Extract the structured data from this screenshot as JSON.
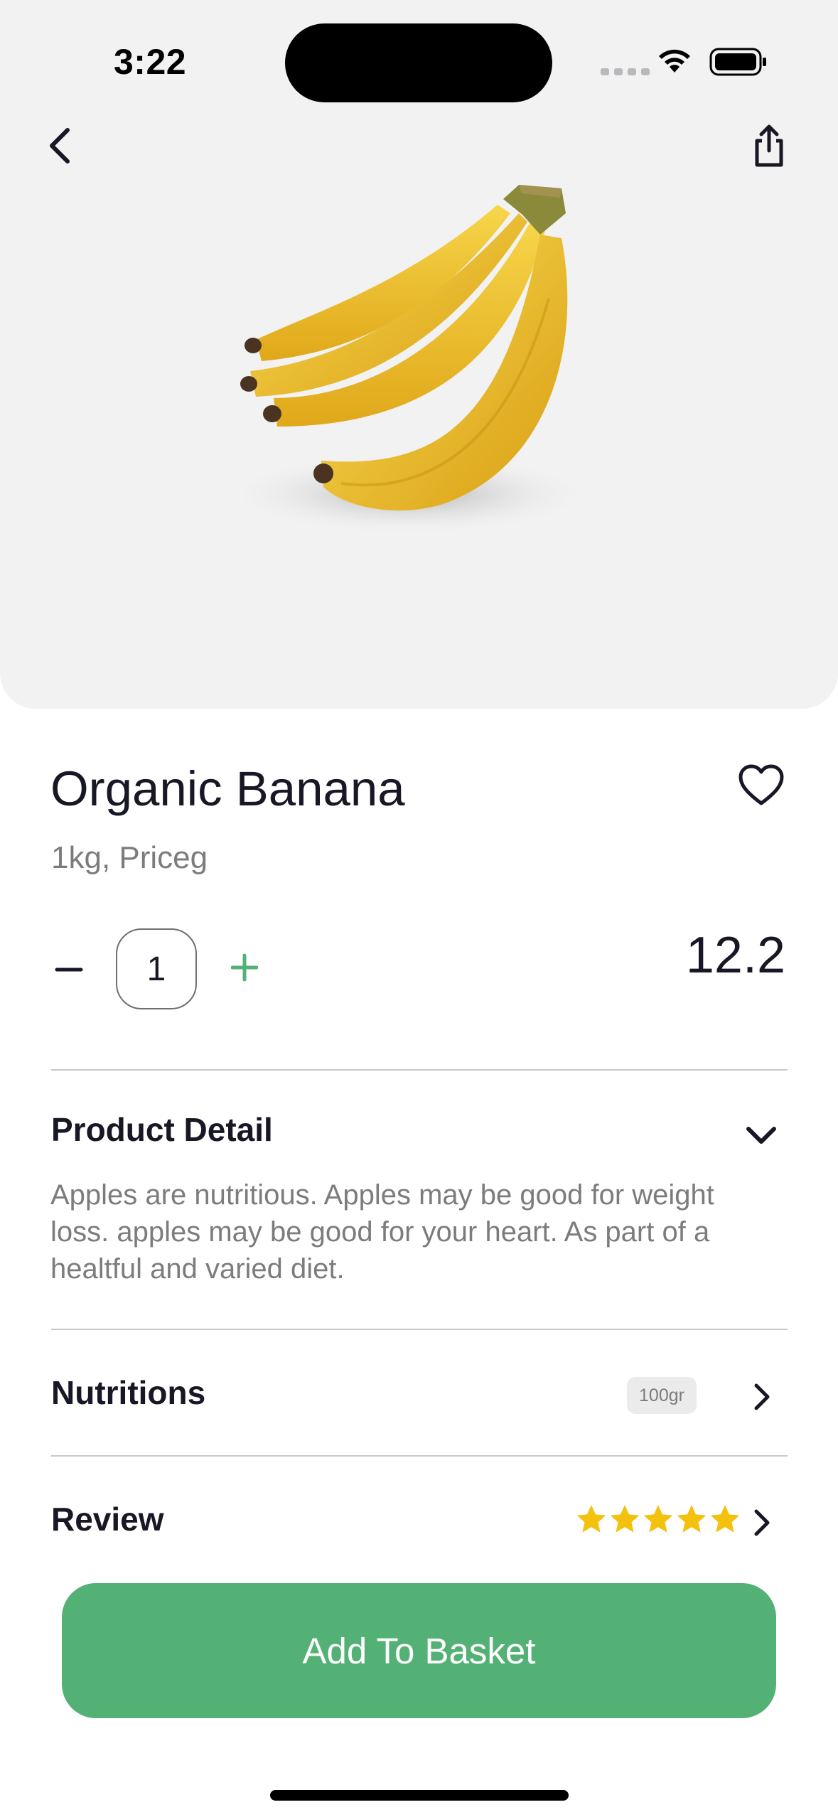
{
  "status_bar": {
    "time": "3:22"
  },
  "product": {
    "name": "Organic Banana",
    "unit_price_label": "1kg, Priceg",
    "quantity": "1",
    "price": "12.2",
    "image_icon": "banana-bunch-image"
  },
  "sections": {
    "detail": {
      "title": "Product Detail",
      "text": "Apples are nutritious. Apples may be good for weight loss. apples may be good for your heart. As part of a healtful and varied diet."
    },
    "nutritions": {
      "title": "Nutritions",
      "badge": "100gr"
    },
    "review": {
      "title": "Review",
      "rating": 5,
      "max_rating": 5
    }
  },
  "actions": {
    "add_to_basket": "Add To Basket"
  },
  "colors": {
    "accent": "#53b175",
    "hero_background": "#f2f2f2",
    "star": "#f3c10e",
    "text_primary": "#181725",
    "text_secondary": "#7c7c7c"
  },
  "icons": [
    "back-chevron-icon",
    "share-icon",
    "heart-icon",
    "minus-icon",
    "plus-icon",
    "chevron-down-icon",
    "chevron-right-icon",
    "star-icon",
    "wifi-icon",
    "battery-icon"
  ]
}
